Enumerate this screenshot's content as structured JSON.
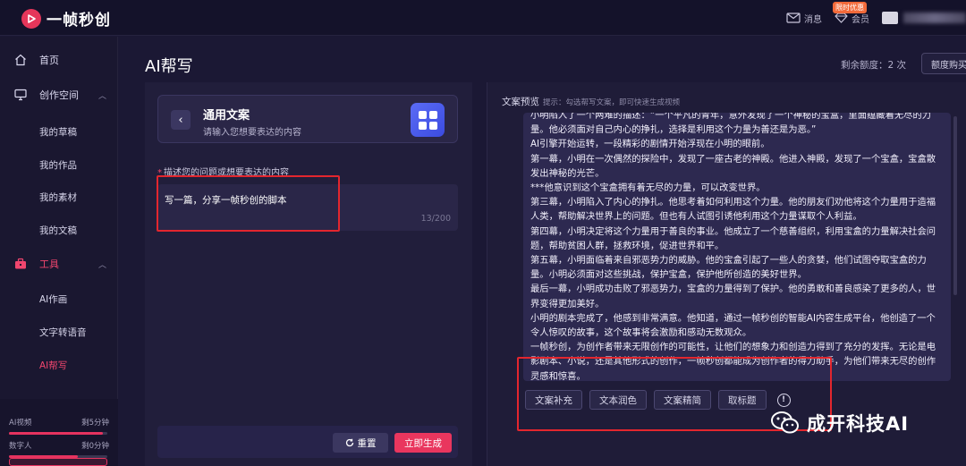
{
  "app": {
    "name": "一帧秒创",
    "brand_color": "#e5365a"
  },
  "topbar": {
    "messages_label": "消息",
    "member_label": "会员",
    "promo_badge": "限时优惠"
  },
  "sidebar": {
    "items": [
      {
        "label": "首页",
        "icon": "home-icon"
      },
      {
        "label": "创作空间",
        "icon": "monitor-icon"
      },
      {
        "label": "我的草稿"
      },
      {
        "label": "我的作品"
      },
      {
        "label": "我的素材"
      },
      {
        "label": "我的文稿"
      },
      {
        "label": "工具",
        "icon": "toolbox-icon"
      },
      {
        "label": "AI作画"
      },
      {
        "label": "文字转语音"
      },
      {
        "label": "AI帮写"
      }
    ],
    "quota": [
      {
        "name": "AI视频",
        "remaining": "剩5分钟",
        "fill": 0.95
      },
      {
        "name": "数字人",
        "remaining": "剩0分钟",
        "fill": 0.7
      }
    ]
  },
  "main": {
    "page_title": "AI帮写",
    "remaining_label": "剩余额度：",
    "remaining_value": "2 次",
    "buy_label": "额度购买",
    "template": {
      "title": "通用文案",
      "subtitle": "请输入您想要表达的内容"
    },
    "prompt": {
      "label": "描述您的问题或想要表达的内容",
      "value": "写一篇，分享一帧秒创的脚本",
      "count": "13/200"
    },
    "reset_label": "重置",
    "generate_label": "立即生成",
    "preview": {
      "title": "文案预览",
      "hint": "提示：勾选帮写文案，即可快速生成视频",
      "paragraphs": [
        "小明陷入了一个两难的描述：“一个平凡的青年，意外发现了一个神秘的宝盒，里面蕴藏着无尽的力量。他必须面对自己内心的挣扎，选择是利用这个力量为善还是为恶。”",
        "AI引擎开始运转，一段精彩的剧情开始浮现在小明的眼前。",
        "第一幕，小明在一次偶然的探险中，发现了一座古老的神殿。他进入神殿，发现了一个宝盒，宝盒散发出神秘的光芒。",
        "***他意识到这个宝盒拥有着无尽的力量，可以改变世界。",
        "第三幕，小明陷入了内心的挣扎。他思考着如何利用这个力量。他的朋友们劝他将这个力量用于造福人类，帮助解决世界上的问题。但也有人试图引诱他利用这个力量谋取个人利益。",
        "第四幕，小明决定将这个力量用于善良的事业。他成立了一个慈善组织，利用宝盒的力量解决社会问题，帮助贫困人群，拯救环境，促进世界和平。",
        "第五幕，小明面临着来自邪恶势力的威胁。他的宝盒引起了一些人的贪婪，他们试图夺取宝盒的力量。小明必须面对这些挑战，保护宝盒，保护他所创造的美好世界。",
        "最后一幕，小明成功击败了邪恶势力，宝盒的力量得到了保护。他的勇敢和善良感染了更多的人，世界变得更加美好。",
        "小明的剧本完成了，他感到非常满意。他知道，通过一帧秒创的智能AI内容生成平台，他创造了一个令人惊叹的故事，这个故事将会激励和感动无数观众。",
        "一帧秒创，为创作者带来无限创作的可能性，让他们的想象力和创造力得到了充分的发挥。无论是电影剧本、小说，还是其他形式的创作，一帧秒创都能成为创作者的得力助手，为他们带来无尽的创作灵感和惊喜。"
      ]
    },
    "actions": [
      "文案补充",
      "文本润色",
      "文案精简",
      "取标题"
    ]
  },
  "watermark": {
    "text": "成开科技AI"
  }
}
